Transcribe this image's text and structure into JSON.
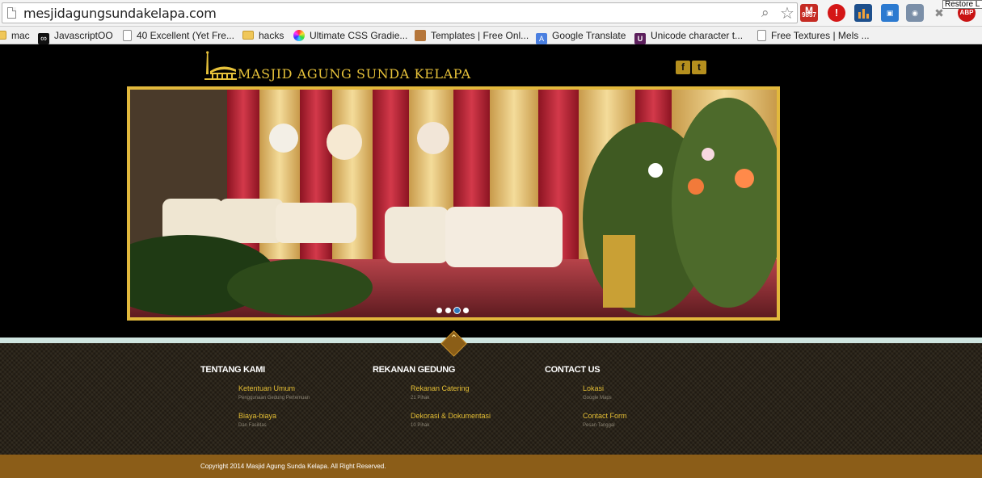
{
  "browser": {
    "url": "mesjidagungsundakelapa.com",
    "tooltip": "Restore L",
    "extensions": {
      "gmail_count": "9857",
      "abp_label": "ABP"
    }
  },
  "bookmarks": [
    {
      "label": "mac",
      "icon": "folder-icon"
    },
    {
      "label": "JavascriptOO",
      "icon": "infinity-icon"
    },
    {
      "label": "40 Excellent (Yet Fre...",
      "icon": "page-icon"
    },
    {
      "label": "hacks",
      "icon": "folder-icon"
    },
    {
      "label": "Ultimate CSS Gradie...",
      "icon": "color-wheel-icon"
    },
    {
      "label": "Templates | Free Onl...",
      "icon": "box-icon"
    },
    {
      "label": "Google Translate",
      "icon": "translate-icon"
    },
    {
      "label": "Unicode character t...",
      "icon": "unicode-icon"
    },
    {
      "label": "Free Textures | Mels ...",
      "icon": "page-icon"
    }
  ],
  "site": {
    "logo_text": "MASJID AGUNG SUNDA KELAPA",
    "social": {
      "facebook": "f",
      "twitter": "t"
    },
    "slider": {
      "slide_count": 4,
      "active_index": 2
    },
    "footer": {
      "columns": [
        {
          "title": "TENTANG KAMI",
          "items": [
            {
              "label": "Ketentuan Umum",
              "sub": "Penggunaan Gedung Pertemuan"
            },
            {
              "label": "Biaya-biaya",
              "sub": "Dan Fasilitas"
            }
          ]
        },
        {
          "title": "REKANAN GEDUNG",
          "items": [
            {
              "label": "Rekanan Catering",
              "sub": "21 Pihak"
            },
            {
              "label": "Dekorasi & Dokumentasi",
              "sub": "10 Pihak"
            }
          ]
        },
        {
          "title": "CONTACT US",
          "items": [
            {
              "label": "Lokasi",
              "sub": "Google Maps"
            },
            {
              "label": "Contact Form",
              "sub": "Pesan Tanggal"
            }
          ]
        }
      ],
      "copyright": "Copyright 2014 Masjid Agung Sunda Kelapa. All Right Reserved."
    }
  },
  "colors": {
    "gold": "#e2b83c",
    "footer_brown": "#8b5d18",
    "active_dot": "#2e78bd"
  }
}
